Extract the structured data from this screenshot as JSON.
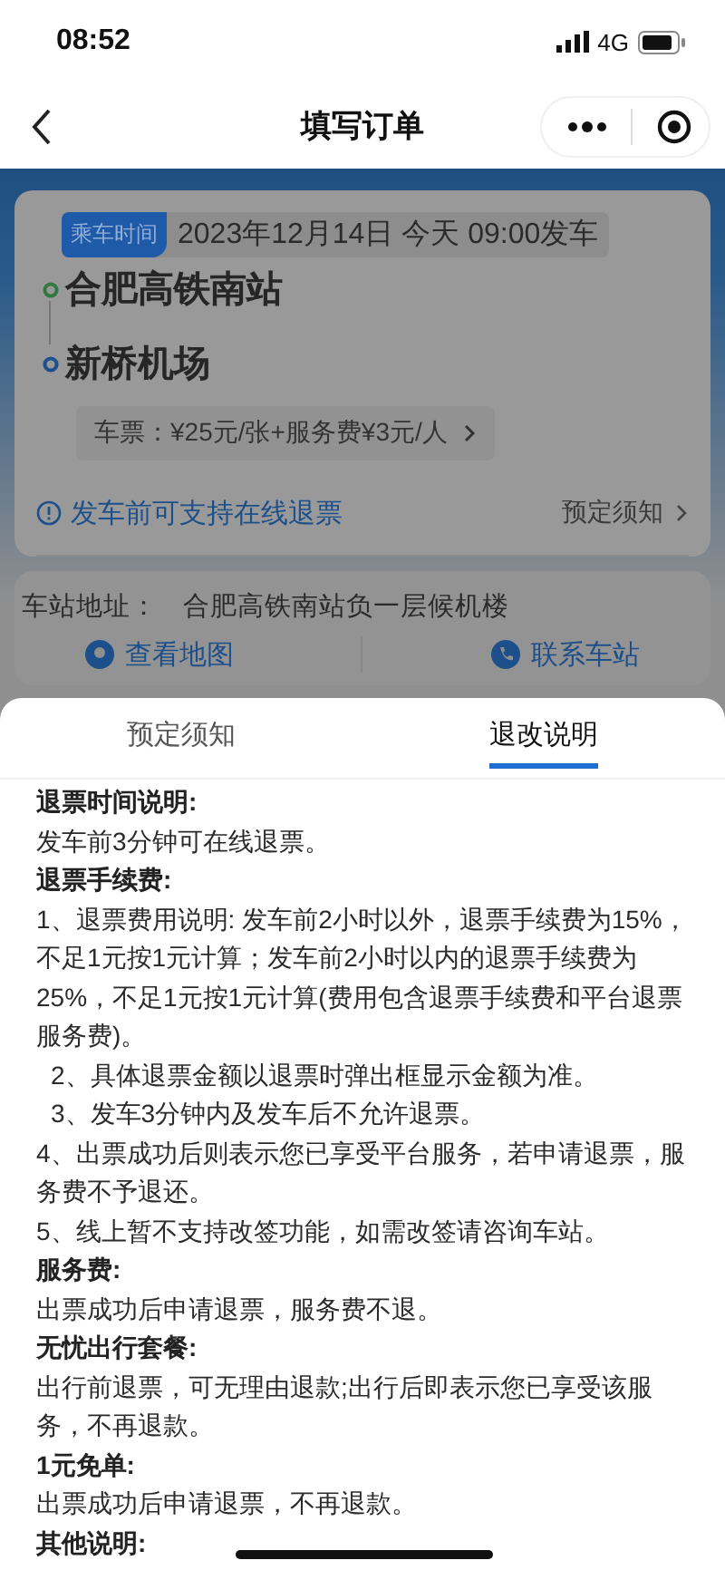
{
  "status_bar": {
    "time": "08:52",
    "network": "4G"
  },
  "nav": {
    "title": "填写订单"
  },
  "order_card": {
    "time_tag": "乘车时间",
    "departure_time": "2023年12月14日 今天 09:00发车",
    "stops": [
      {
        "name": "合肥高铁南站",
        "kind": "origin"
      },
      {
        "name": "新桥机场",
        "kind": "destination"
      }
    ],
    "price": "车票：¥25元/张+服务费¥3元/人",
    "refund_notice": "发车前可支持在线退票",
    "notice_link": "预定须知"
  },
  "station_card": {
    "address_label": "车站地址：",
    "address": "合肥高铁南站负一层候机楼",
    "actions": [
      {
        "label": "查看地图",
        "kind": "map"
      },
      {
        "label": "联系车站",
        "kind": "phone"
      }
    ]
  },
  "sheet": {
    "tabs": [
      {
        "label": "预定须知",
        "selected": false
      },
      {
        "label": "退改说明",
        "selected": true
      }
    ],
    "content": [
      {
        "kind": "heading",
        "text": "退票时间说明:"
      },
      {
        "kind": "text",
        "text": "发车前3分钟可在线退票。"
      },
      {
        "kind": "heading",
        "text": "退票手续费:"
      },
      {
        "kind": "text",
        "text": "1、退票费用说明: 发车前2小时以外，退票手续费为15%，不足1元按1元计算；发车前2小时以内的退票手续费为25%，不足1元按1元计算(费用包含退票手续费和平台退票服务费)。"
      },
      {
        "kind": "indented",
        "text": "2、具体退票金额以退票时弹出框显示金额为准。"
      },
      {
        "kind": "indented",
        "text": "3、发车3分钟内及发车后不允许退票。"
      },
      {
        "kind": "text",
        "text": "4、出票成功后则表示您已享受平台服务，若申请退票，服务费不予退还。"
      },
      {
        "kind": "text",
        "text": "5、线上暂不支持改签功能，如需改签请咨询车站。"
      },
      {
        "kind": "heading",
        "text": "服务费:"
      },
      {
        "kind": "text",
        "text": "出票成功后申请退票，服务费不退。"
      },
      {
        "kind": "heading",
        "text": "无忧出行套餐:"
      },
      {
        "kind": "text",
        "text": "出行前退票，可无理由退款;出行后即表示您已享受该服务，不再退款。"
      },
      {
        "kind": "heading",
        "text": "1元免单:"
      },
      {
        "kind": "text",
        "text": "出票成功后申请退票，不再退款。"
      },
      {
        "kind": "heading",
        "text": "其他说明:"
      }
    ]
  }
}
